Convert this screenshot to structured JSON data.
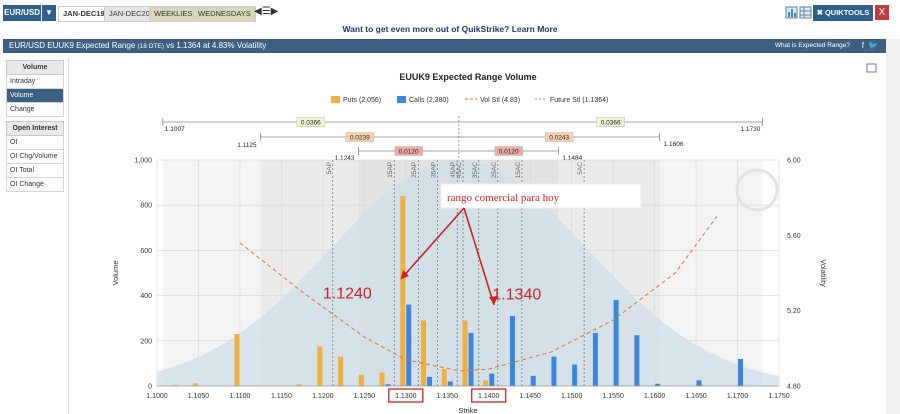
{
  "topbar": {
    "symbol": "EUR/USD",
    "tabs": [
      "JAN-DEC19",
      "JAN-DEC20",
      "WEEKLIES",
      "WEDNESDAYS"
    ],
    "quicktools_label": "QUIKTOOLS",
    "close_label": "X"
  },
  "banner": {
    "text": "Want to get even more out of QuikStrike? Learn More"
  },
  "titlebar": {
    "title_a": "EUR/USD EUUK9 Expected Range",
    "title_dte": "(18 DTE)",
    "title_b": "vs 1.1364 at 4.83% Volatility",
    "help": "What is Expected Range?"
  },
  "sidebar": {
    "group1_header": "Volume",
    "group1_items": [
      "Intraday",
      "Volume",
      "Change"
    ],
    "group2_header": "Open Interest",
    "group2_items": [
      "OI",
      "OI Chg/Volume",
      "OI Total",
      "OI Change"
    ]
  },
  "colors": {
    "puts": "#f0b040",
    "calls": "#3a86dd",
    "future": "#e07a3a",
    "vol": "#e06030",
    "highlight": "#cc2222",
    "bell": "#cfdfea"
  },
  "chart_data": {
    "type": "bar",
    "title": "EUUK9 Expected Range Volume",
    "xlabel": "Strike",
    "ylabel": "Volume",
    "y2label": "Volatility",
    "xlim": [
      1.1,
      1.175
    ],
    "ylim": [
      0,
      1000
    ],
    "y2lim": [
      4.8,
      6.0
    ],
    "x_ticks": [
      "1.1000",
      "1.1050",
      "1.1100",
      "1.1150",
      "1.1200",
      "1.1250",
      "1.1300",
      "1.1350",
      "1.1400",
      "1.1450",
      "1.1500",
      "1.1550",
      "1.1600",
      "1.1650",
      "1.1700",
      "1.1750"
    ],
    "y_ticks": [
      "0",
      "200",
      "400",
      "600",
      "800",
      "1,000"
    ],
    "y2_ticks": [
      "4.80",
      "5.20",
      "5.60",
      "6.00"
    ],
    "legend": [
      "Puts (2,056)",
      "Calls (2,380)",
      "Vol Stl (4.83)",
      "Future Stl (1.1364)"
    ],
    "puts": {
      "name": "Puts (2,056)",
      "x": [
        1.1025,
        1.105,
        1.11,
        1.1175,
        1.12,
        1.1225,
        1.125,
        1.1275,
        1.13,
        1.1325,
        1.135,
        1.1375,
        1.14
      ],
      "values": [
        5,
        12,
        230,
        8,
        175,
        130,
        50,
        60,
        840,
        290,
        75,
        290,
        25
      ]
    },
    "calls": {
      "name": "Calls (2,380)",
      "x": [
        1.1275,
        1.13,
        1.1325,
        1.135,
        1.1375,
        1.14,
        1.1425,
        1.145,
        1.1475,
        1.15,
        1.1525,
        1.155,
        1.1575,
        1.16,
        1.165,
        1.17
      ],
      "values": [
        8,
        360,
        40,
        20,
        235,
        55,
        310,
        45,
        130,
        95,
        235,
        380,
        225,
        10,
        25,
        120
      ]
    },
    "future_line": {
      "x": [
        1.11,
        1.1175,
        1.125,
        1.13,
        1.1364,
        1.14,
        1.1475,
        1.155,
        1.1625,
        1.1675
      ],
      "values": [
        5.56,
        5.3,
        5.06,
        4.94,
        4.88,
        4.89,
        4.98,
        5.15,
        5.4,
        5.7
      ]
    },
    "future_settle": 1.1364,
    "range_brackets": [
      {
        "low": "1.1007",
        "high": "1.1730",
        "width": "0.0366",
        "low_x": 1.1007,
        "high_x": 1.173
      },
      {
        "low": "1.1125",
        "high": "1.1606",
        "width": "0.0239",
        "width_right": "0.0243",
        "low_x": 1.1125,
        "high_x": 1.1606
      },
      {
        "low": "1.1243",
        "high": "1.1484",
        "width": "0.0120",
        "low_x": 1.1243,
        "high_x": 1.1484
      }
    ],
    "strike_labels": [
      {
        "x": 1.1212,
        "text": "5AP"
      },
      {
        "x": 1.1286,
        "text": "15AP"
      },
      {
        "x": 1.1315,
        "text": "25AP"
      },
      {
        "x": 1.1338,
        "text": "35AP"
      },
      {
        "x": 1.1362,
        "text": "45AP"
      },
      {
        "x": 1.1369,
        "text": "45AC"
      },
      {
        "x": 1.1388,
        "text": "35AC"
      },
      {
        "x": 1.1411,
        "text": "25AC"
      },
      {
        "x": 1.144,
        "text": "15AC"
      },
      {
        "x": 1.1515,
        "text": "5AC"
      }
    ],
    "annotations": [
      {
        "text": "rango comercial para hoy",
        "x": 1.1374,
        "y": 830
      },
      {
        "text": "1.1240",
        "x": 1.1276,
        "y": 370
      },
      {
        "text": "1.1340",
        "x": 1.142,
        "y": 375
      }
    ],
    "highlighted_ticks": [
      "1.1300",
      "1.1400"
    ]
  }
}
